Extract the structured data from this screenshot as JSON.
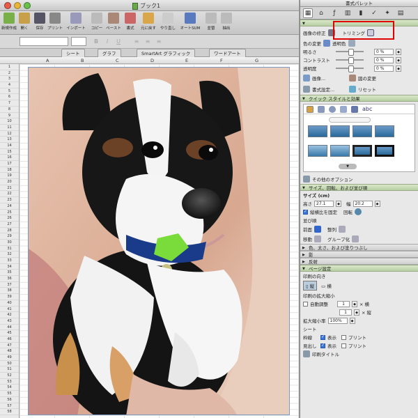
{
  "window": {
    "title": "ブック1"
  },
  "toolbar": {
    "buttons": [
      {
        "label": "新規作成",
        "icon": "new-doc-icon"
      },
      {
        "label": "開く",
        "icon": "open-folder-icon"
      },
      {
        "label": "保存",
        "icon": "save-icon"
      },
      {
        "label": "プリント",
        "icon": "print-icon"
      },
      {
        "label": "インポート",
        "icon": "import-icon"
      },
      {
        "label": "コピー",
        "icon": "copy-icon"
      },
      {
        "label": "ペースト",
        "icon": "paste-icon"
      },
      {
        "label": "書式",
        "icon": "format-brush-icon"
      },
      {
        "label": "元に戻す",
        "icon": "undo-icon"
      },
      {
        "label": "やり直し",
        "icon": "redo-icon"
      },
      {
        "label": "オートSUM",
        "icon": "sum-icon"
      },
      {
        "label": "並替",
        "icon": "sort-icon"
      },
      {
        "label": "抽出",
        "icon": "filter-icon"
      }
    ]
  },
  "ribbon": {
    "tabs": [
      "シート",
      "グラフ",
      "SmartArt グラフィック",
      "ワードアート"
    ]
  },
  "grid": {
    "columns": [
      "A",
      "B",
      "C",
      "D",
      "E",
      "F",
      "G"
    ],
    "rows": [
      "1",
      "2",
      "3",
      "4",
      "5",
      "6",
      "7",
      "8",
      "9",
      "10",
      "11",
      "12",
      "13",
      "14",
      "15",
      "16",
      "17",
      "18",
      "19",
      "20",
      "21",
      "22",
      "23",
      "24",
      "25",
      "26",
      "27",
      "28",
      "29",
      "30",
      "31",
      "32",
      "33",
      "34",
      "35",
      "36",
      "37",
      "38",
      "39",
      "40",
      "41",
      "42",
      "43",
      "44",
      "45",
      "46",
      "47",
      "48",
      "49",
      "50",
      "51",
      "52",
      "53",
      "54",
      "55",
      "56",
      "57",
      "58"
    ]
  },
  "panel": {
    "title": "書式パレット",
    "picture_section": {
      "crop_label": "画像の修正",
      "trimming_label": "トリミング",
      "recolor_label": "色の変更",
      "transparent_label": "透明色",
      "brightness_label": "明るさ",
      "contrast_label": "コントラスト",
      "transparency_label": "透明度",
      "brightness_value": "0 %",
      "contrast_value": "0 %",
      "transparency_value": "0 %",
      "image_btn": "画像...",
      "restore_btn": "図の変更",
      "format_btn": "書式設定...",
      "reset_btn": "リセット"
    },
    "quick_styles": {
      "header": "クイック スタイルと効果",
      "more": "その他のオプション",
      "tab_text": "abc"
    },
    "size_section": {
      "header": "サイズ、回転、および並び順",
      "size_label": "サイズ (cm)",
      "height_label": "高さ",
      "height_value": "27.1",
      "width_label": "幅",
      "width_value": "20.2",
      "lock_label": "縦横比を固定",
      "rotate_label": "回転",
      "order_label": "並び順",
      "front_label": "前面",
      "align_label": "整列",
      "move_label": "移動",
      "group_label": "グループ化"
    },
    "collapsed": [
      "色、太さ、および塗りつぶし",
      "影",
      "反射"
    ],
    "page_section": {
      "header": "ページ設定",
      "orientation_label": "印刷の向き",
      "portrait": "縦",
      "landscape": "横",
      "scale_label": "印刷の拡大縮小",
      "autofit_label": "自動調整",
      "fit_w": "1",
      "fit_h": "1",
      "times_w": "× 横",
      "times_h": "× 縦",
      "zoom_label": "拡大縮小率",
      "zoom_value": "100%",
      "sheet_label": "シート",
      "grid_label": "枠線",
      "show1": "表示",
      "print1": "プリント",
      "heading_label": "見出し",
      "show2": "表示",
      "print2": "プリント",
      "print_title": "印刷タイトル"
    }
  },
  "colors": {
    "accent_red": "#e00000",
    "section_green": "#c4d8b0"
  }
}
